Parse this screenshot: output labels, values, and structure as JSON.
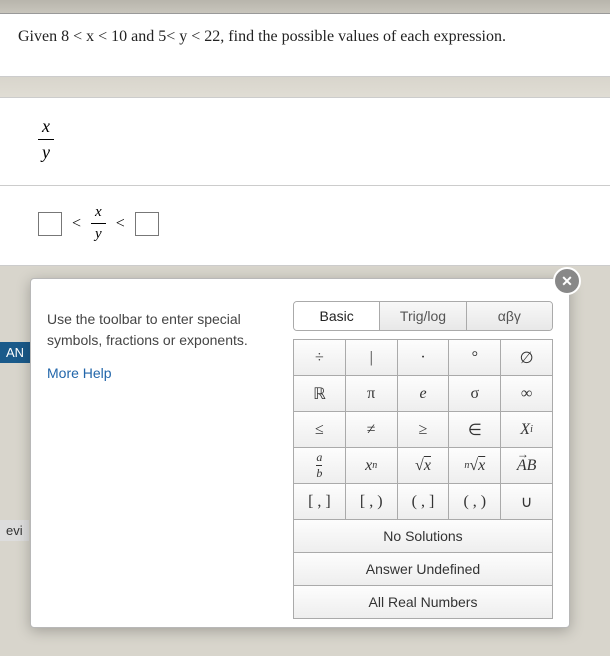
{
  "question": "Given 8 < x < 10  and 5< y < 22, find the possible values of each expression.",
  "expression": {
    "numerator": "x",
    "denominator": "y"
  },
  "answer_template": {
    "lt1": "<",
    "frac_num": "x",
    "frac_den": "y",
    "lt2": "<"
  },
  "side_tabs": {
    "an": "AN",
    "evi": "evi"
  },
  "panel": {
    "close": "✕",
    "instruction": "Use the toolbar to enter special symbols, fractions or exponents.",
    "more_help": "More Help",
    "tabs": [
      "Basic",
      "Trig/log",
      "αβγ"
    ],
    "symbols": [
      [
        "÷",
        "|",
        "·",
        "°",
        "∅"
      ],
      [
        "ℝ",
        "π",
        "e",
        "σ",
        "∞"
      ],
      [
        "≤",
        "≠",
        "≥",
        "∈",
        "Xᵢ"
      ],
      [
        "a/b",
        "xⁿ",
        "√x",
        "ⁿ√x",
        "AB→"
      ],
      [
        "[ , ]",
        "[ , )",
        "( , ]",
        "( , )",
        "∪"
      ]
    ],
    "phrases": [
      "No Solutions",
      "Answer Undefined",
      "All Real Numbers"
    ]
  }
}
